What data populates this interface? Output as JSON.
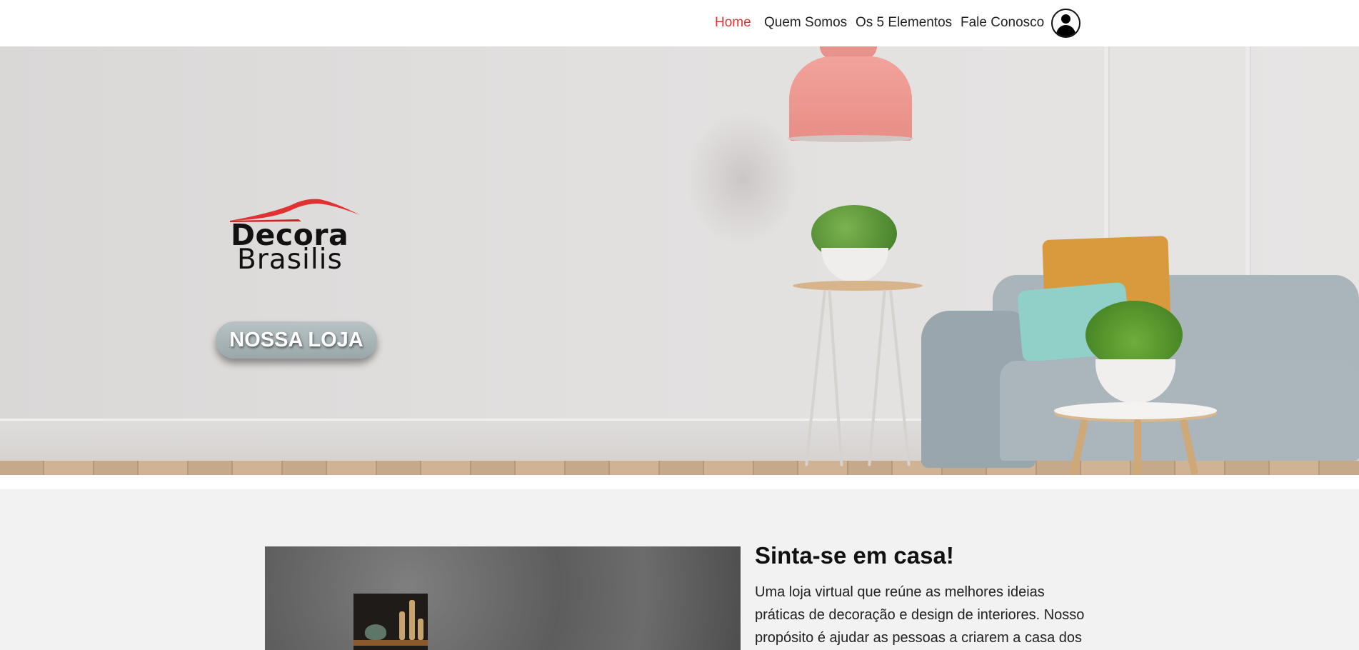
{
  "nav": {
    "items": [
      {
        "label": "Home",
        "active": true
      },
      {
        "label": "Quem Somos",
        "active": false
      },
      {
        "label": "Os 5 Elementos",
        "active": false
      },
      {
        "label": "Fale Conosco",
        "active": false
      }
    ],
    "active_color": "#e03232"
  },
  "hero": {
    "logo_line1": "Decora",
    "logo_line2": "Brasilis",
    "logo_accent_color": "#e03232",
    "shop_button_label": "NOSSA LOJA"
  },
  "about": {
    "title": "Sinta-se em casa!",
    "text": "Uma loja virtual que reúne as melhores ideias práticas de decoração e design de interiores. Nosso propósito é ajudar as pessoas a criarem a casa dos"
  }
}
